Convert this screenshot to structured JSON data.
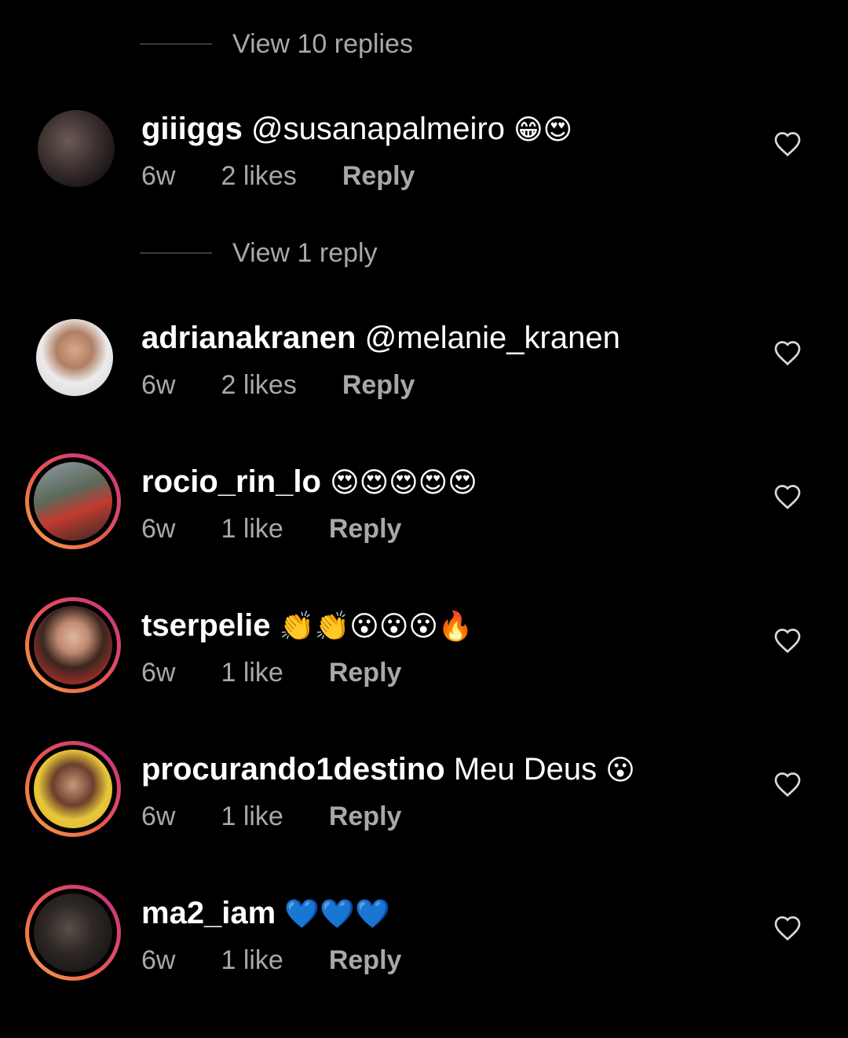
{
  "view_replies_top": "View 10 replies",
  "view_replies_mid": "View 1 reply",
  "comments": [
    {
      "username": "giiiggs",
      "text": "@susanapalmeiro",
      "emoji": "😁😍",
      "time": "6w",
      "likes": "2 likes",
      "reply": "Reply"
    },
    {
      "username": "adrianakranen",
      "text": "@melanie_kranen",
      "emoji": "",
      "time": "6w",
      "likes": "2 likes",
      "reply": "Reply"
    },
    {
      "username": "rocio_rin_lo",
      "text": "",
      "emoji": "😍😍😍😍😍",
      "time": "6w",
      "likes": "1 like",
      "reply": "Reply"
    },
    {
      "username": "tserpelie",
      "text": "",
      "emoji": "👏👏😮😮😮🔥",
      "time": "6w",
      "likes": "1 like",
      "reply": "Reply"
    },
    {
      "username": "procurando1destino",
      "text": "Meu Deus",
      "emoji": "😮",
      "time": "6w",
      "likes": "1 like",
      "reply": "Reply"
    },
    {
      "username": "ma2_iam",
      "text": "",
      "emoji": "💙💙💙",
      "time": "6w",
      "likes": "1 like",
      "reply": "Reply"
    }
  ],
  "icons": {
    "like": "heart-outline-icon"
  },
  "colors": {
    "background": "#000000",
    "secondary_text": "#a8a8a8",
    "story_ring_start": "#f6a64b",
    "story_ring_end": "#c22f8b"
  }
}
